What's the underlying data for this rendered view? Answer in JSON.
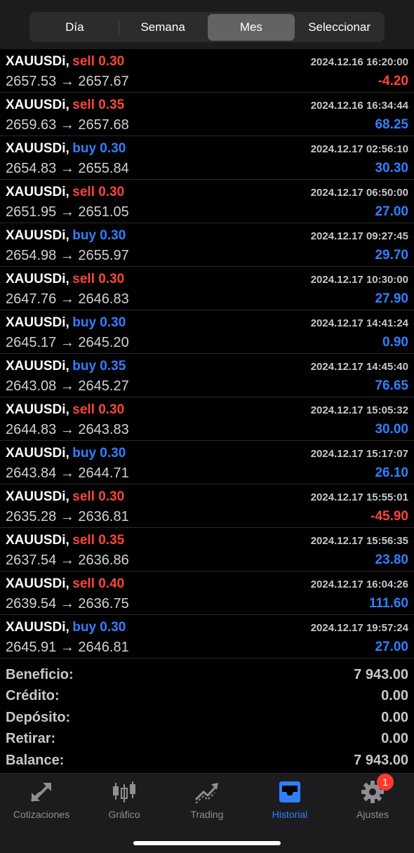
{
  "segments": [
    {
      "label": "Día"
    },
    {
      "label": "Semana"
    },
    {
      "label": "Mes"
    },
    {
      "label": "Seleccionar"
    }
  ],
  "trades": [
    {
      "symbol": "XAUUSDi,",
      "side": "sell 0.30",
      "type": "sell",
      "time": "2024.12.16 16:20:00",
      "prices": "2657.53 → 2657.67",
      "profit": "-4.20",
      "sign": "neg"
    },
    {
      "symbol": "XAUUSDi,",
      "side": "sell 0.35",
      "type": "sell",
      "time": "2024.12.16 16:34:44",
      "prices": "2659.63 → 2657.68",
      "profit": "68.25",
      "sign": "pos"
    },
    {
      "symbol": "XAUUSDi,",
      "side": "buy 0.30",
      "type": "buy",
      "time": "2024.12.17 02:56:10",
      "prices": "2654.83 → 2655.84",
      "profit": "30.30",
      "sign": "pos"
    },
    {
      "symbol": "XAUUSDi,",
      "side": "sell 0.30",
      "type": "sell",
      "time": "2024.12.17 06:50:00",
      "prices": "2651.95 → 2651.05",
      "profit": "27.00",
      "sign": "pos"
    },
    {
      "symbol": "XAUUSDi,",
      "side": "buy 0.30",
      "type": "buy",
      "time": "2024.12.17 09:27:45",
      "prices": "2654.98 → 2655.97",
      "profit": "29.70",
      "sign": "pos"
    },
    {
      "symbol": "XAUUSDi,",
      "side": "sell 0.30",
      "type": "sell",
      "time": "2024.12.17 10:30:00",
      "prices": "2647.76 → 2646.83",
      "profit": "27.90",
      "sign": "pos"
    },
    {
      "symbol": "XAUUSDi,",
      "side": "buy 0.30",
      "type": "buy",
      "time": "2024.12.17 14:41:24",
      "prices": "2645.17 → 2645.20",
      "profit": "0.90",
      "sign": "pos"
    },
    {
      "symbol": "XAUUSDi,",
      "side": "buy 0.35",
      "type": "buy",
      "time": "2024.12.17 14:45:40",
      "prices": "2643.08 → 2645.27",
      "profit": "76.65",
      "sign": "pos"
    },
    {
      "symbol": "XAUUSDi,",
      "side": "sell 0.30",
      "type": "sell",
      "time": "2024.12.17 15:05:32",
      "prices": "2644.83 → 2643.83",
      "profit": "30.00",
      "sign": "pos"
    },
    {
      "symbol": "XAUUSDi,",
      "side": "buy 0.30",
      "type": "buy",
      "time": "2024.12.17 15:17:07",
      "prices": "2643.84 → 2644.71",
      "profit": "26.10",
      "sign": "pos"
    },
    {
      "symbol": "XAUUSDi,",
      "side": "sell 0.30",
      "type": "sell",
      "time": "2024.12.17 15:55:01",
      "prices": "2635.28 → 2636.81",
      "profit": "-45.90",
      "sign": "neg"
    },
    {
      "symbol": "XAUUSDi,",
      "side": "sell 0.35",
      "type": "sell",
      "time": "2024.12.17 15:56:35",
      "prices": "2637.54 → 2636.86",
      "profit": "23.80",
      "sign": "pos"
    },
    {
      "symbol": "XAUUSDi,",
      "side": "sell 0.40",
      "type": "sell",
      "time": "2024.12.17 16:04:26",
      "prices": "2639.54 → 2636.75",
      "profit": "111.60",
      "sign": "pos"
    },
    {
      "symbol": "XAUUSDi,",
      "side": "buy 0.30",
      "type": "buy",
      "time": "2024.12.17 19:57:24",
      "prices": "2645.91 → 2646.81",
      "profit": "27.00",
      "sign": "pos"
    }
  ],
  "summary": [
    {
      "label": "Beneficio:",
      "value": "7 943.00"
    },
    {
      "label": "Crédito:",
      "value": "0.00"
    },
    {
      "label": "Depósito:",
      "value": "0.00"
    },
    {
      "label": "Retirar:",
      "value": "0.00"
    },
    {
      "label": "Balance:",
      "value": "7 943.00"
    }
  ],
  "tabs": [
    {
      "label": "Cotizaciones",
      "icon": "quotes-arrows-icon"
    },
    {
      "label": "Gráfico",
      "icon": "candlestick-chart-icon"
    },
    {
      "label": "Trading",
      "icon": "trading-trend-icon"
    },
    {
      "label": "Historial",
      "icon": "history-inbox-icon"
    },
    {
      "label": "Ajustes",
      "icon": "settings-gear-icon",
      "badge": "1"
    }
  ],
  "colors": {
    "sell": "#ff453a",
    "buy": "#2f80ff",
    "active_tab": "#2f80ff",
    "inactive_tab": "#8e8e93"
  }
}
